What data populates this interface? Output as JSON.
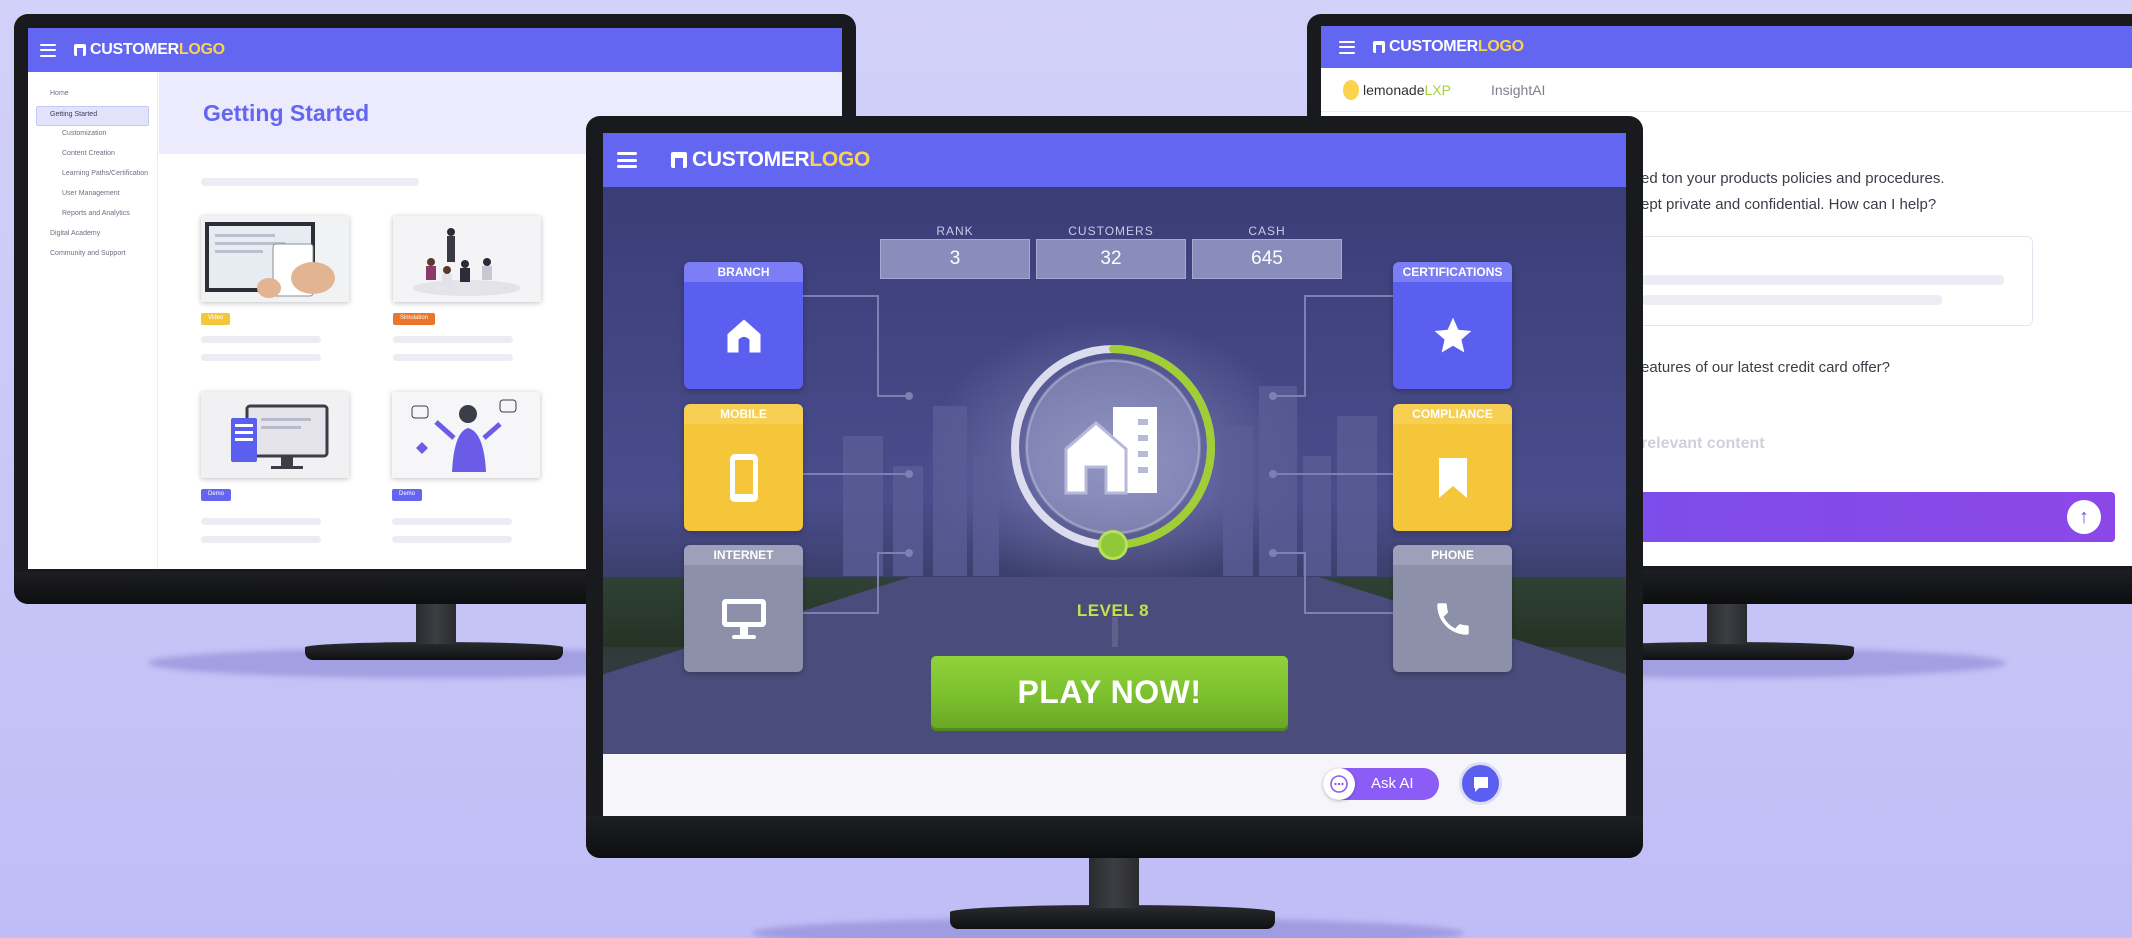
{
  "brand": {
    "logo_word1": "CUSTOMER",
    "logo_word2": "LOGO",
    "accent": "#6366f1",
    "logo_accent": "#fcd34d"
  },
  "left_screen": {
    "sidebar": [
      {
        "label": "Home",
        "indent": false,
        "active": false
      },
      {
        "label": "Getting Started",
        "indent": false,
        "active": true
      },
      {
        "label": "Customization",
        "indent": true,
        "active": false
      },
      {
        "label": "Content Creation",
        "indent": true,
        "active": false
      },
      {
        "label": "Learning Paths/Certification",
        "indent": true,
        "active": false
      },
      {
        "label": "User Management",
        "indent": true,
        "active": false
      },
      {
        "label": "Reports and Analytics",
        "indent": true,
        "active": false
      },
      {
        "label": "Digital Academy",
        "indent": false,
        "active": false
      },
      {
        "label": "Community and Support",
        "indent": false,
        "active": false
      }
    ],
    "page_title": "Getting Started",
    "cards": [
      {
        "badge": "Video",
        "badge_color": "#f5c53a"
      },
      {
        "badge": "Simulation",
        "badge_color": "#e8762c"
      },
      {
        "badge": "Demo",
        "badge_color": "#6366f1"
      },
      {
        "badge": "Demo",
        "badge_color": "#6366f1"
      }
    ]
  },
  "right_screen": {
    "brand_name": "lemonade",
    "brand_suffix": "LXP",
    "tab2": "InsightAI",
    "message_line1": "ed ton your products policies and procedures.",
    "message_line2": "ept private and confidential. How can I help?",
    "question": "eatures of our latest credit card offer?",
    "searching": "relevant content",
    "send_icon": "arrow-up-icon"
  },
  "game": {
    "stats": [
      {
        "label": "RANK",
        "value": "3"
      },
      {
        "label": "CUSTOMERS",
        "value": "32"
      },
      {
        "label": "CASH",
        "value": "645"
      }
    ],
    "tiles_left": [
      {
        "label": "BRANCH",
        "icon": "home-icon",
        "color": "blue"
      },
      {
        "label": "MOBILE",
        "icon": "smartphone-icon",
        "color": "yellow"
      },
      {
        "label": "INTERNET",
        "icon": "desktop-icon",
        "color": "gray"
      }
    ],
    "tiles_right": [
      {
        "label": "CERTIFICATIONS",
        "icon": "star-icon",
        "color": "blue"
      },
      {
        "label": "COMPLIANCE",
        "icon": "bookmark-icon",
        "color": "yellow"
      },
      {
        "label": "PHONE",
        "icon": "phone-icon",
        "color": "gray"
      }
    ],
    "level": "LEVEL 8",
    "level_progress": 0.5,
    "play_label": "PLAY NOW!"
  },
  "footer": {
    "ask_ai_label": "Ask AI",
    "chat_icon": "chat-bubble-icon"
  }
}
